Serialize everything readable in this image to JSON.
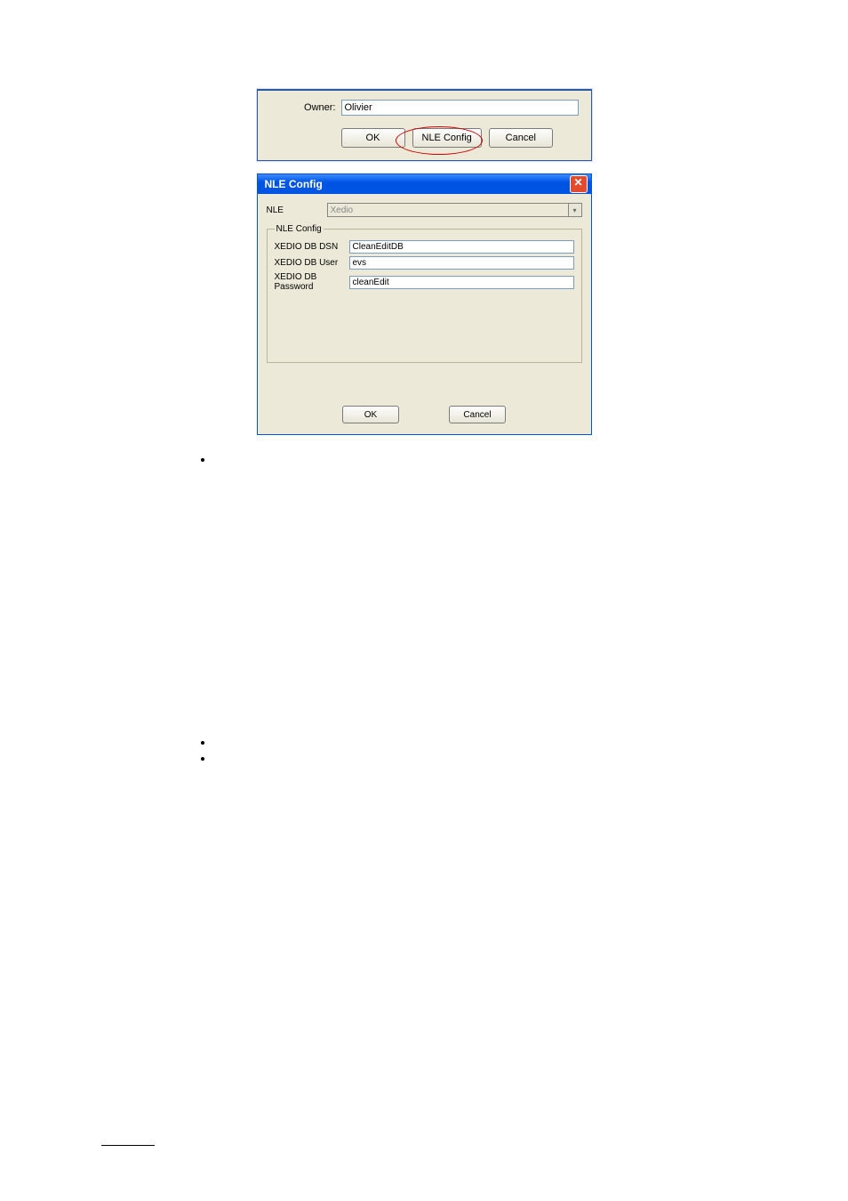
{
  "dlg1": {
    "owner_label": "Owner:",
    "owner_value": "Olivier",
    "ok": "OK",
    "nle_config": "NLE Config",
    "cancel": "Cancel"
  },
  "dlg2": {
    "title": "NLE Config",
    "nle_label": "NLE",
    "nle_value": "Xedio",
    "fieldset": "NLE Config",
    "f1_label": "XEDIO DB DSN",
    "f1_value": "CleanEditDB",
    "f2_label": "XEDIO DB User",
    "f2_value": "evs",
    "f3_label": "XEDIO DB Password",
    "f3_value": "cleanEdit",
    "ok": "OK",
    "cancel": "Cancel",
    "close_glyph": "✕"
  },
  "chevron": "▾"
}
